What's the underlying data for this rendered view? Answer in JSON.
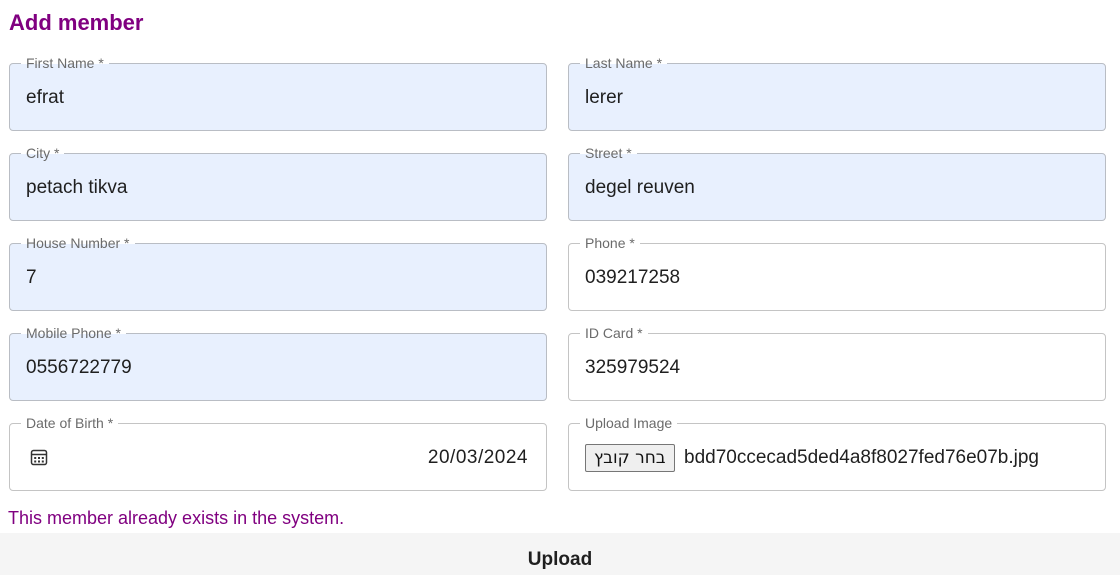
{
  "form": {
    "title": "Add member",
    "fields": {
      "first_name": {
        "label": "First Name *",
        "value": "efrat"
      },
      "last_name": {
        "label": "Last Name *",
        "value": "lerer"
      },
      "city": {
        "label": "City *",
        "value": "petach tikva"
      },
      "street": {
        "label": "Street *",
        "value": "degel reuven"
      },
      "house_number": {
        "label": "House Number *",
        "value": "7"
      },
      "phone": {
        "label": "Phone *",
        "value": "039217258"
      },
      "mobile_phone": {
        "label": "Mobile Phone *",
        "value": "0556722779"
      },
      "id_card": {
        "label": "ID Card *",
        "value": "325979524"
      },
      "date_of_birth": {
        "label": "Date of Birth *",
        "value": "20/03/2024",
        "icon": "calendar-icon"
      },
      "upload_image": {
        "label": "Upload Image",
        "button_label": "בחר קובץ",
        "file_name": "bdd70ccecad5ded4a8f8027fed76e07b.jpg"
      }
    },
    "error_message": "This member already exists in the system.",
    "submit_label": "Upload"
  },
  "colors": {
    "accent": "#800080",
    "autofill_bg": "#e8f0fe"
  }
}
